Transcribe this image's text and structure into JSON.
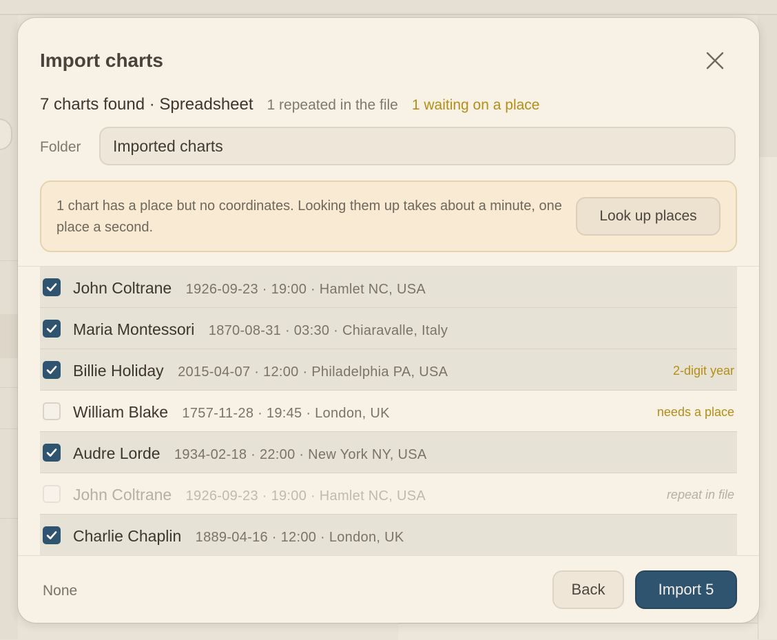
{
  "dialog": {
    "title": "Import charts",
    "summary": {
      "found": "7 charts found · Spreadsheet",
      "repeated": "1 repeated in the file",
      "waiting": "1 waiting on a place"
    },
    "folder": {
      "label": "Folder",
      "value": "Imported charts"
    },
    "notice": {
      "text": "1 chart has a place but no coordinates. Looking them up takes about a minute, one place a second.",
      "button_label": "Look up places"
    },
    "rows": [
      {
        "name": "John Coltrane",
        "details": "1926-09-23 · 19:00 · Hamlet NC, USA",
        "checked": true,
        "note": ""
      },
      {
        "name": "Maria Montessori",
        "details": "1870-08-31 · 03:30 · Chiaravalle, Italy",
        "checked": true,
        "note": ""
      },
      {
        "name": "Billie Holiday",
        "details": "2015-04-07 · 12:00 · Philadelphia PA, USA",
        "checked": true,
        "note": "2-digit year"
      },
      {
        "name": "William Blake",
        "details": "1757-11-28 · 19:45 · London, UK",
        "checked": false,
        "note": "needs a place"
      },
      {
        "name": "Audre Lorde",
        "details": "1934-02-18 · 22:00 · New York NY, USA",
        "checked": true,
        "note": ""
      },
      {
        "name": "John Coltrane",
        "details": "1926-09-23 · 19:00 · Hamlet NC, USA",
        "checked": false,
        "note": "repeat in file"
      },
      {
        "name": "Charlie Chaplin",
        "details": "1889-04-16 · 12:00 · London, UK",
        "checked": true,
        "note": ""
      }
    ],
    "footer": {
      "none_label": "None",
      "back_label": "Back",
      "import_label": "Import 5"
    }
  },
  "colors": {
    "accent": "#2f5470",
    "warning": "#b48f13",
    "dialog_bg": "#f8f1e5",
    "notice_bg": "#f8ead3"
  },
  "icons": {
    "close": "close-icon",
    "check": "checkmark-icon"
  }
}
